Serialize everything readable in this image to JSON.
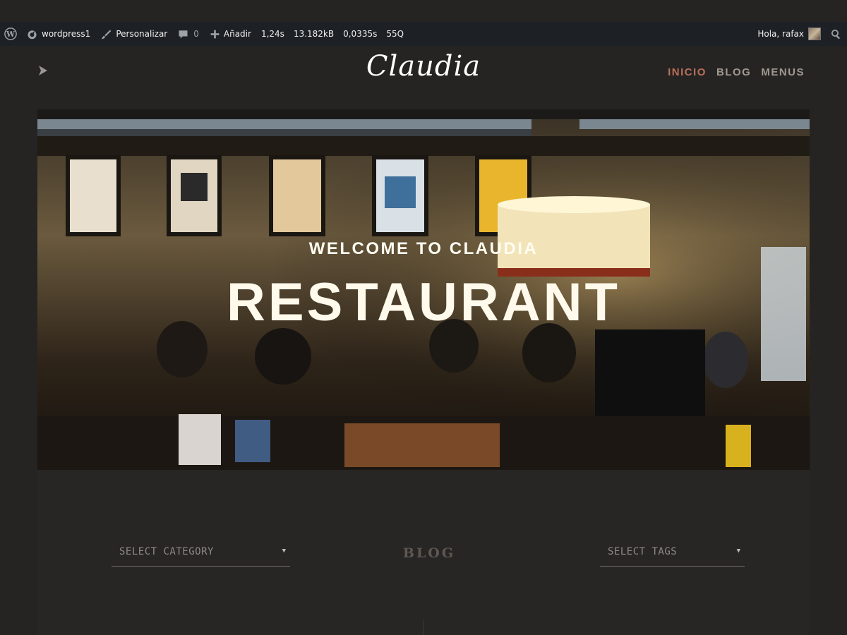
{
  "adminbar": {
    "site_name": "wordpress1",
    "customize": "Personalizar",
    "comments_count": "0",
    "add_new": "Añadir",
    "stats": [
      "1,24s",
      "13.182kB",
      "0,0335s",
      "55Q"
    ],
    "greeting": "Hola, rafax"
  },
  "header": {
    "logo": "Claudia",
    "nav": [
      "INICIO",
      "BLOG",
      "MENUS"
    ]
  },
  "hero": {
    "welcome": "WELCOME TO CLAUDIA",
    "title": "RESTAURANT"
  },
  "content": {
    "category_select": "SELECT CATEGORY",
    "blog_heading": "BLOG",
    "tags_select": "SELECT TAGS"
  },
  "colors": {
    "active_nav": "#b8705a",
    "nav": "#a09991",
    "adminbar_bg": "#1d2125",
    "page_bg": "#252422"
  }
}
